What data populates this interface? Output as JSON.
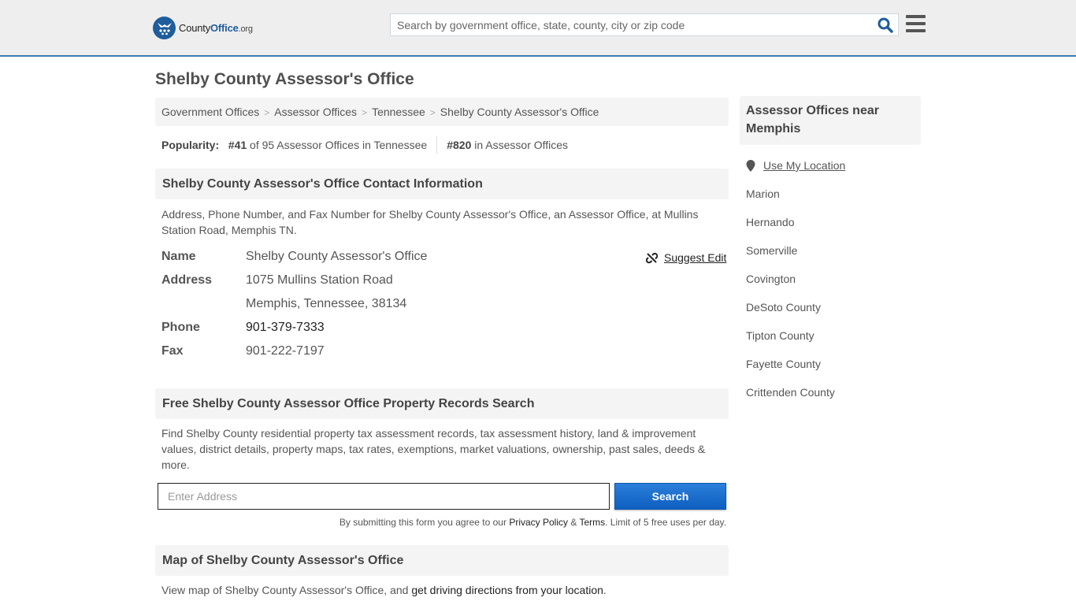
{
  "header": {
    "logo": {
      "word1": "County",
      "word2": "Office",
      "suffix": ".org"
    },
    "search_placeholder": "Search by government office, state, county, city or zip code",
    "search_icon": "search-icon",
    "menu_icon": "hamburger-menu-icon"
  },
  "page_title": "Shelby County Assessor's Office",
  "breadcrumb": [
    {
      "label": "Government Offices"
    },
    {
      "label": "Assessor Offices"
    },
    {
      "label": "Tennessee"
    },
    {
      "label": "Shelby County Assessor's Office"
    }
  ],
  "breadcrumb_separator": ">",
  "popularity": {
    "label": "Popularity:",
    "state_rank": "#41",
    "state_text": "of 95 Assessor Offices in Tennessee",
    "national_rank": "#820",
    "national_text": "in Assessor Offices"
  },
  "contact": {
    "heading": "Shelby County Assessor's Office Contact Information",
    "description": "Address, Phone Number, and Fax Number for Shelby County Assessor's Office, an Assessor Office, at Mullins Station Road, Memphis TN.",
    "suggest_edit": "Suggest Edit",
    "rows": {
      "name": {
        "label": "Name",
        "value": "Shelby County Assessor's Office"
      },
      "address": {
        "label": "Address",
        "line1": "1075 Mullins Station Road",
        "line2": "Memphis, Tennessee, 38134"
      },
      "phone": {
        "label": "Phone",
        "value": "901-379-7333"
      },
      "fax": {
        "label": "Fax",
        "value": "901-222-7197"
      }
    }
  },
  "records": {
    "heading": "Free Shelby County Assessor Office Property Records Search",
    "description": "Find Shelby County residential property tax assessment records, tax assessment history, land & improvement values, district details, property maps, tax rates, exemptions, market valuations, ownership, past sales, deeds & more.",
    "address_placeholder": "Enter Address",
    "search_button": "Search",
    "disclaimer_prefix": "By submitting this form you agree to our ",
    "privacy_link": "Privacy Policy",
    "amp": " & ",
    "terms_link": "Terms",
    "disclaimer_suffix": ". Limit of 5 free uses per day."
  },
  "map": {
    "heading": "Map of Shelby County Assessor's Office",
    "text_prefix": "View map of Shelby County Assessor's Office, and ",
    "directions_link": "get driving directions from your location",
    "text_suffix": "."
  },
  "sidebar": {
    "heading": "Assessor Offices near Memphis",
    "use_location": "Use My Location",
    "links": [
      {
        "label": "Marion"
      },
      {
        "label": "Hernando"
      },
      {
        "label": "Somerville"
      },
      {
        "label": "Covington"
      },
      {
        "label": "DeSoto County"
      },
      {
        "label": "Tipton County"
      },
      {
        "label": "Fayette County"
      },
      {
        "label": "Crittenden County"
      }
    ]
  },
  "colors": {
    "brand_blue": "#1f5d9c",
    "header_border": "#3c7ab0",
    "button_blue": "#0e5fc0",
    "panel_gray": "#f4f4f4"
  }
}
